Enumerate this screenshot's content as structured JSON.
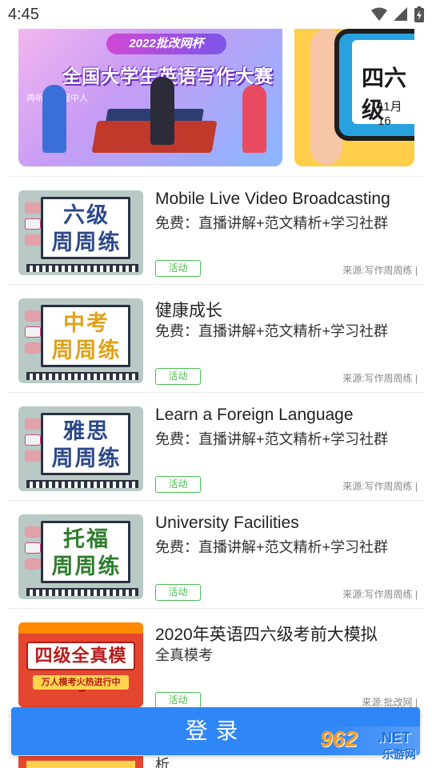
{
  "status_bar": {
    "time": "4:45"
  },
  "banners": [
    {
      "pill": "2022批改网杯",
      "title": "全国大学生英语写作大赛",
      "subtitle": "再听已是程中人"
    },
    {
      "title": "四六级",
      "date": "11月16"
    }
  ],
  "courses": [
    {
      "thumb_text": "六级\n周周练",
      "thumb_color": "#2c4a8a",
      "title": "Mobile Live Video Broadcasting",
      "subtitle": "免费：直播讲解+范文精析+学习社群",
      "tag": "活动",
      "source": "来源:写作周周练"
    },
    {
      "thumb_text": "中考\n周周练",
      "thumb_color": "#e0a21a",
      "title": "健康成长",
      "subtitle": "免费：直播讲解+范文精析+学习社群",
      "tag": "活动",
      "source": "来源:写作周周练"
    },
    {
      "thumb_text": "雅思\n周周练",
      "thumb_color": "#2c4a8a",
      "title": "Learn a Foreign Language",
      "subtitle": "免费：直播讲解+范文精析+学习社群",
      "tag": "活动",
      "source": "来源:写作周周练"
    },
    {
      "thumb_text": "托福\n周周练",
      "thumb_color": "#2f7d2f",
      "title": "University Facilities",
      "subtitle": "免费：直播讲解+范文精析+学习社群",
      "tag": "活动",
      "source": "来源:写作周周练"
    },
    {
      "thumb_text": "四级全真模考",
      "thumb_tag": "万人模考火热进行中",
      "thumb_color": "#b61c1c",
      "title": "2020年英语四六级考前大模拟",
      "subtitle": "全真模考",
      "tag": "活动",
      "source": "来源:批改网"
    }
  ],
  "peek": {
    "text": "析"
  },
  "login_button": {
    "label": "登录"
  },
  "watermark": {
    "logo": "962",
    "net": ".NET",
    "sub": "乐游网"
  },
  "colors": {
    "accent": "#2f86f6",
    "tag_green": "#4cbb52"
  }
}
